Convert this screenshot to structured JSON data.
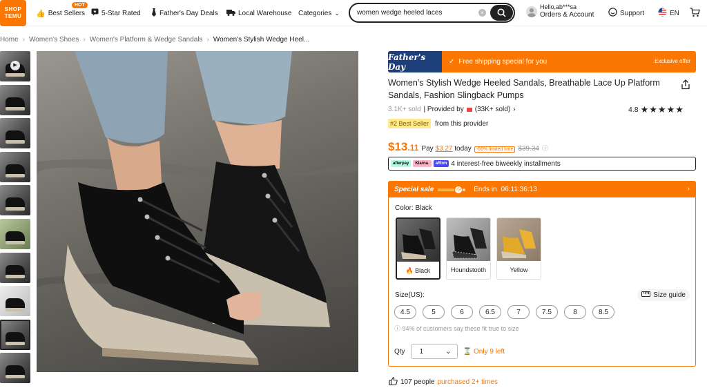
{
  "header": {
    "logo_top": "SHOP",
    "logo_bottom": "TEMU",
    "nav": [
      {
        "label": "Best Sellers",
        "icon": "thumbs-up-icon",
        "badge": "HOT"
      },
      {
        "label": "5-Star Rated",
        "icon": "star-chat-icon"
      },
      {
        "label": "Father's Day Deals",
        "icon": "tie-icon"
      },
      {
        "label": "Local Warehouse",
        "icon": "truck-icon"
      },
      {
        "label": "Categories",
        "icon": "chevron-down-icon"
      }
    ],
    "search_value": "women wedge heeled laces",
    "account_greeting": "Hello,ab***sa",
    "account_label": "Orders & Account",
    "support_label": "Support",
    "language": "EN"
  },
  "breadcrumb": [
    "Home",
    "Women's Shoes",
    "Women's Platform & Wedge Sandals",
    "Women's Stylish Wedge Heel..."
  ],
  "banner": {
    "badge": "Father's Day",
    "message": "Free shipping special for you",
    "tag": "Exclusive offer"
  },
  "product": {
    "title": "Women's Stylish Wedge Heeled Sandals, Breathable Lace Up Platform Sandals, Fashion Slingback Pumps",
    "sold": "3.1K+ sold",
    "provided_by": "| Provided by",
    "provider_sold": "(33K+ sold)",
    "rating": "4.8",
    "stars": "★★★★★",
    "best_seller_badge": "#2 Best Seller",
    "best_seller_text": "from this provider",
    "price_currency": "$",
    "price_int": "13",
    "price_dec": ".11",
    "pay_label": "Pay",
    "pay_amount": "$3.27",
    "pay_suffix": "today",
    "limited_badge": "-66% limited time",
    "old_price": "$39.34",
    "installment_logos": [
      "afterpay",
      "Klarna.",
      "affirm"
    ],
    "installment_text": "4 interest-free biweekly installments"
  },
  "deal": {
    "title": "Special sale",
    "countdown_label": "Ends in",
    "countdown": "06:11:36:13",
    "progress": 0.75,
    "color_label": "Color: Black",
    "colors": [
      {
        "name": "Black",
        "hot": true
      },
      {
        "name": "Houndstooth",
        "hot": false
      },
      {
        "name": "Yellow",
        "hot": false
      }
    ],
    "size_label": "Size(US):",
    "size_guide": "Size guide",
    "sizes": [
      "4.5",
      "5",
      "6",
      "6.5",
      "7",
      "7.5",
      "8",
      "8.5"
    ],
    "fit_text": "94% of customers say these fit true to size",
    "qty_label": "Qty",
    "qty_value": "1",
    "stock_text": "Only 9 left"
  },
  "social_proof": {
    "count_text": "107 people",
    "purchased_text": "purchased 2+ times"
  },
  "colors": {
    "accent": "#fb7701",
    "banner_blue": "#1c3f7a"
  }
}
